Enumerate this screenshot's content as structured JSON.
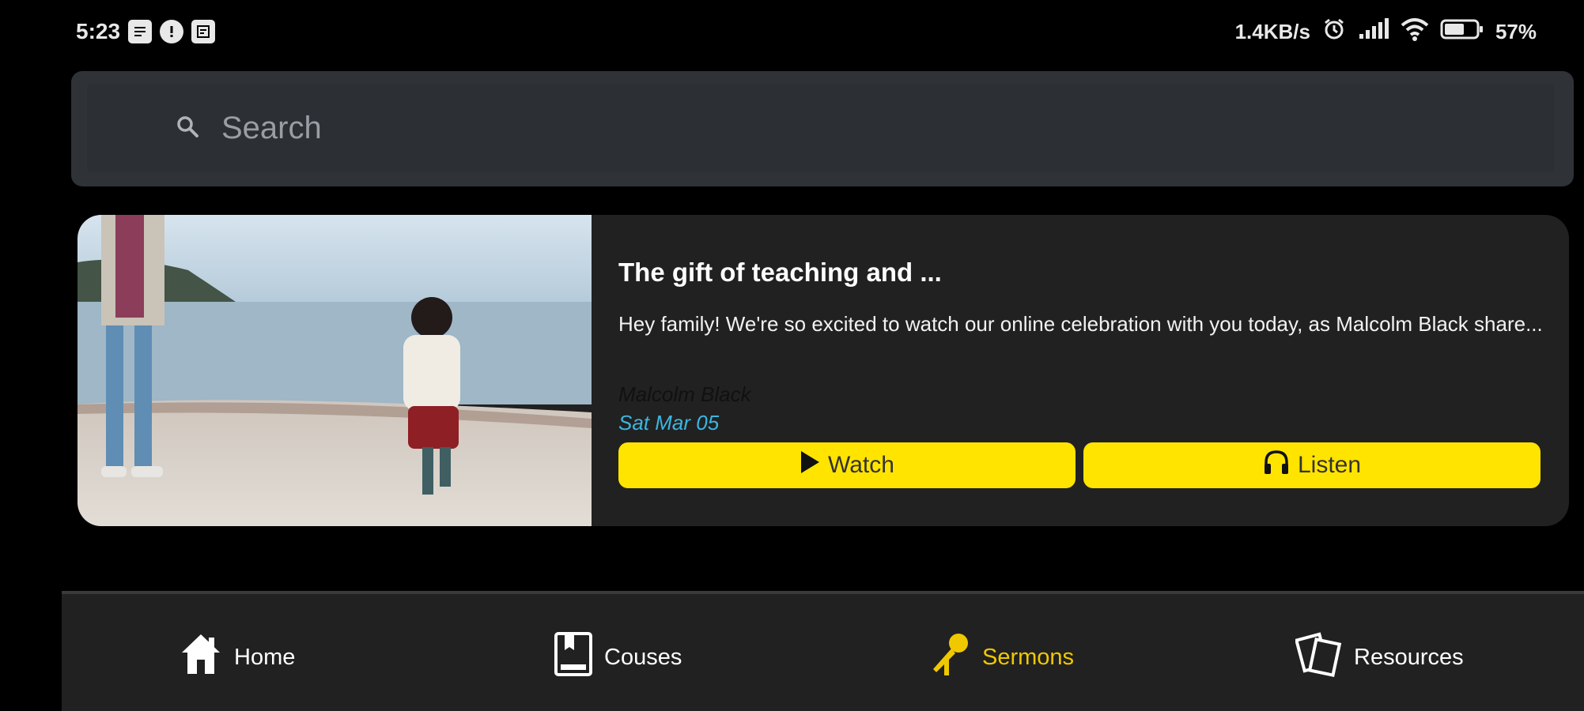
{
  "status_bar": {
    "time": "5:23",
    "network_speed": "1.4KB/s",
    "battery": "57%",
    "icons": [
      "notification-icon",
      "info-icon",
      "calendar-icon",
      "alarm-icon",
      "signal-icon",
      "wifi-icon",
      "battery-icon"
    ]
  },
  "search": {
    "placeholder": "Search"
  },
  "sermon": {
    "title": "The gift of teaching and ...",
    "description": "Hey family! We're so excited to watch our online celebration with you today, as Malcolm Black share...",
    "author": "Malcolm Black",
    "date": "Sat Mar 05",
    "watch_label": "Watch",
    "listen_label": "Listen"
  },
  "nav": {
    "items": [
      {
        "label": "Home",
        "icon": "home-icon",
        "active": false
      },
      {
        "label": "Couses",
        "icon": "book-icon",
        "active": false
      },
      {
        "label": "Sermons",
        "icon": "microphone-icon",
        "active": true
      },
      {
        "label": "Resources",
        "icon": "documents-icon",
        "active": false
      }
    ]
  },
  "colors": {
    "accent": "#ffe400",
    "active_nav": "#f0c800",
    "date": "#3bb6e0",
    "card_bg": "#212121",
    "search_bg": "#2f3236"
  }
}
